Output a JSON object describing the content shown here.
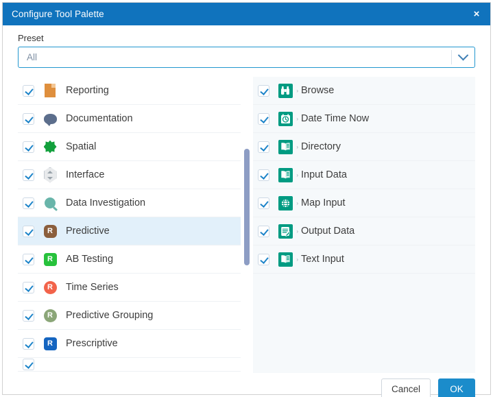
{
  "window": {
    "title": "Configure Tool Palette",
    "close_label": "×",
    "close_icon": "close-icon",
    "accent_color": "#1073bd"
  },
  "preset": {
    "label": "Preset",
    "value": "All",
    "placeholder": "All",
    "arrow_icon": "chevron-down-icon"
  },
  "left_column": {
    "items": [
      {
        "label": "Reporting",
        "checked": true,
        "icon": "document-icon",
        "icon_color": "#df8f3d"
      },
      {
        "label": "Documentation",
        "checked": true,
        "icon": "speech-bubble-icon",
        "icon_color": "#5c6e8c"
      },
      {
        "label": "Spatial",
        "checked": true,
        "icon": "polygon-star-icon",
        "icon_color": "#12a03c"
      },
      {
        "label": "Interface",
        "checked": true,
        "icon": "diamond-arrows-icon",
        "icon_color": "#e8eaec"
      },
      {
        "label": "Data Investigation",
        "checked": true,
        "icon": "magnifier-icon",
        "icon_color": "#69b5aa"
      },
      {
        "label": "Predictive",
        "checked": true,
        "icon": "r-badge-icon",
        "icon_color": "#8b5e3c",
        "selected": true
      },
      {
        "label": "AB Testing",
        "checked": true,
        "icon": "r-badge-icon",
        "icon_color": "#27c23c"
      },
      {
        "label": "Time Series",
        "checked": true,
        "icon": "r-badge-icon",
        "icon_color": "#f2634a"
      },
      {
        "label": "Predictive Grouping",
        "checked": true,
        "icon": "r-badge-icon",
        "icon_color": "#8ba678"
      },
      {
        "label": "Prescriptive",
        "checked": true,
        "icon": "r-badge-icon",
        "icon_color": "#1565c0"
      }
    ]
  },
  "right_column": {
    "items": [
      {
        "label": "Browse",
        "checked": true,
        "icon": "binoculars-icon",
        "icon_color": "#009b82",
        "expander": "›"
      },
      {
        "label": "Date Time Now",
        "checked": true,
        "icon": "clock-icon",
        "icon_color": "#009b82",
        "expander": "›"
      },
      {
        "label": "Directory",
        "checked": true,
        "icon": "open-book-icon",
        "icon_color": "#009b82",
        "expander": "›"
      },
      {
        "label": "Input Data",
        "checked": true,
        "icon": "open-book-icon",
        "icon_color": "#009b82",
        "expander": "›"
      },
      {
        "label": "Map Input",
        "checked": true,
        "icon": "globe-icon",
        "icon_color": "#009b82",
        "expander": "›"
      },
      {
        "label": "Output Data",
        "checked": true,
        "icon": "document-lines-icon",
        "icon_color": "#009b82",
        "expander": "›"
      },
      {
        "label": "Text Input",
        "checked": true,
        "icon": "open-book-icon",
        "icon_color": "#009b82",
        "expander": "›"
      }
    ]
  },
  "footer": {
    "cancel_label": "Cancel",
    "ok_label": "OK"
  }
}
